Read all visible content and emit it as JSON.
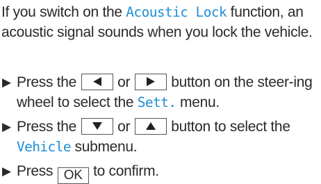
{
  "intro": {
    "before": "If you switch on the ",
    "term": "Acoustic Lock",
    "after": " function, an acoustic signal sounds when you lock the vehicle."
  },
  "steps": [
    {
      "bullet": "▶",
      "t1": "Press the ",
      "t2": " or ",
      "t3": " button on the steer-ing wheel to select the ",
      "term": "Sett.",
      "t4": " menu.",
      "keys": [
        "left-arrow-icon",
        "right-arrow-icon"
      ]
    },
    {
      "bullet": "▶",
      "t1": "Press the ",
      "t2": " or ",
      "t3": " button to select the ",
      "term": "Vehicle",
      "t4": " submenu.",
      "keys": [
        "down-arrow-icon",
        "up-arrow-icon"
      ]
    },
    {
      "bullet": "▶",
      "t1": "Press ",
      "key_label": "OK",
      "t2": " to confirm."
    }
  ],
  "colors": {
    "display_term": "#1f8fd6",
    "text": "#2a2a2a"
  }
}
